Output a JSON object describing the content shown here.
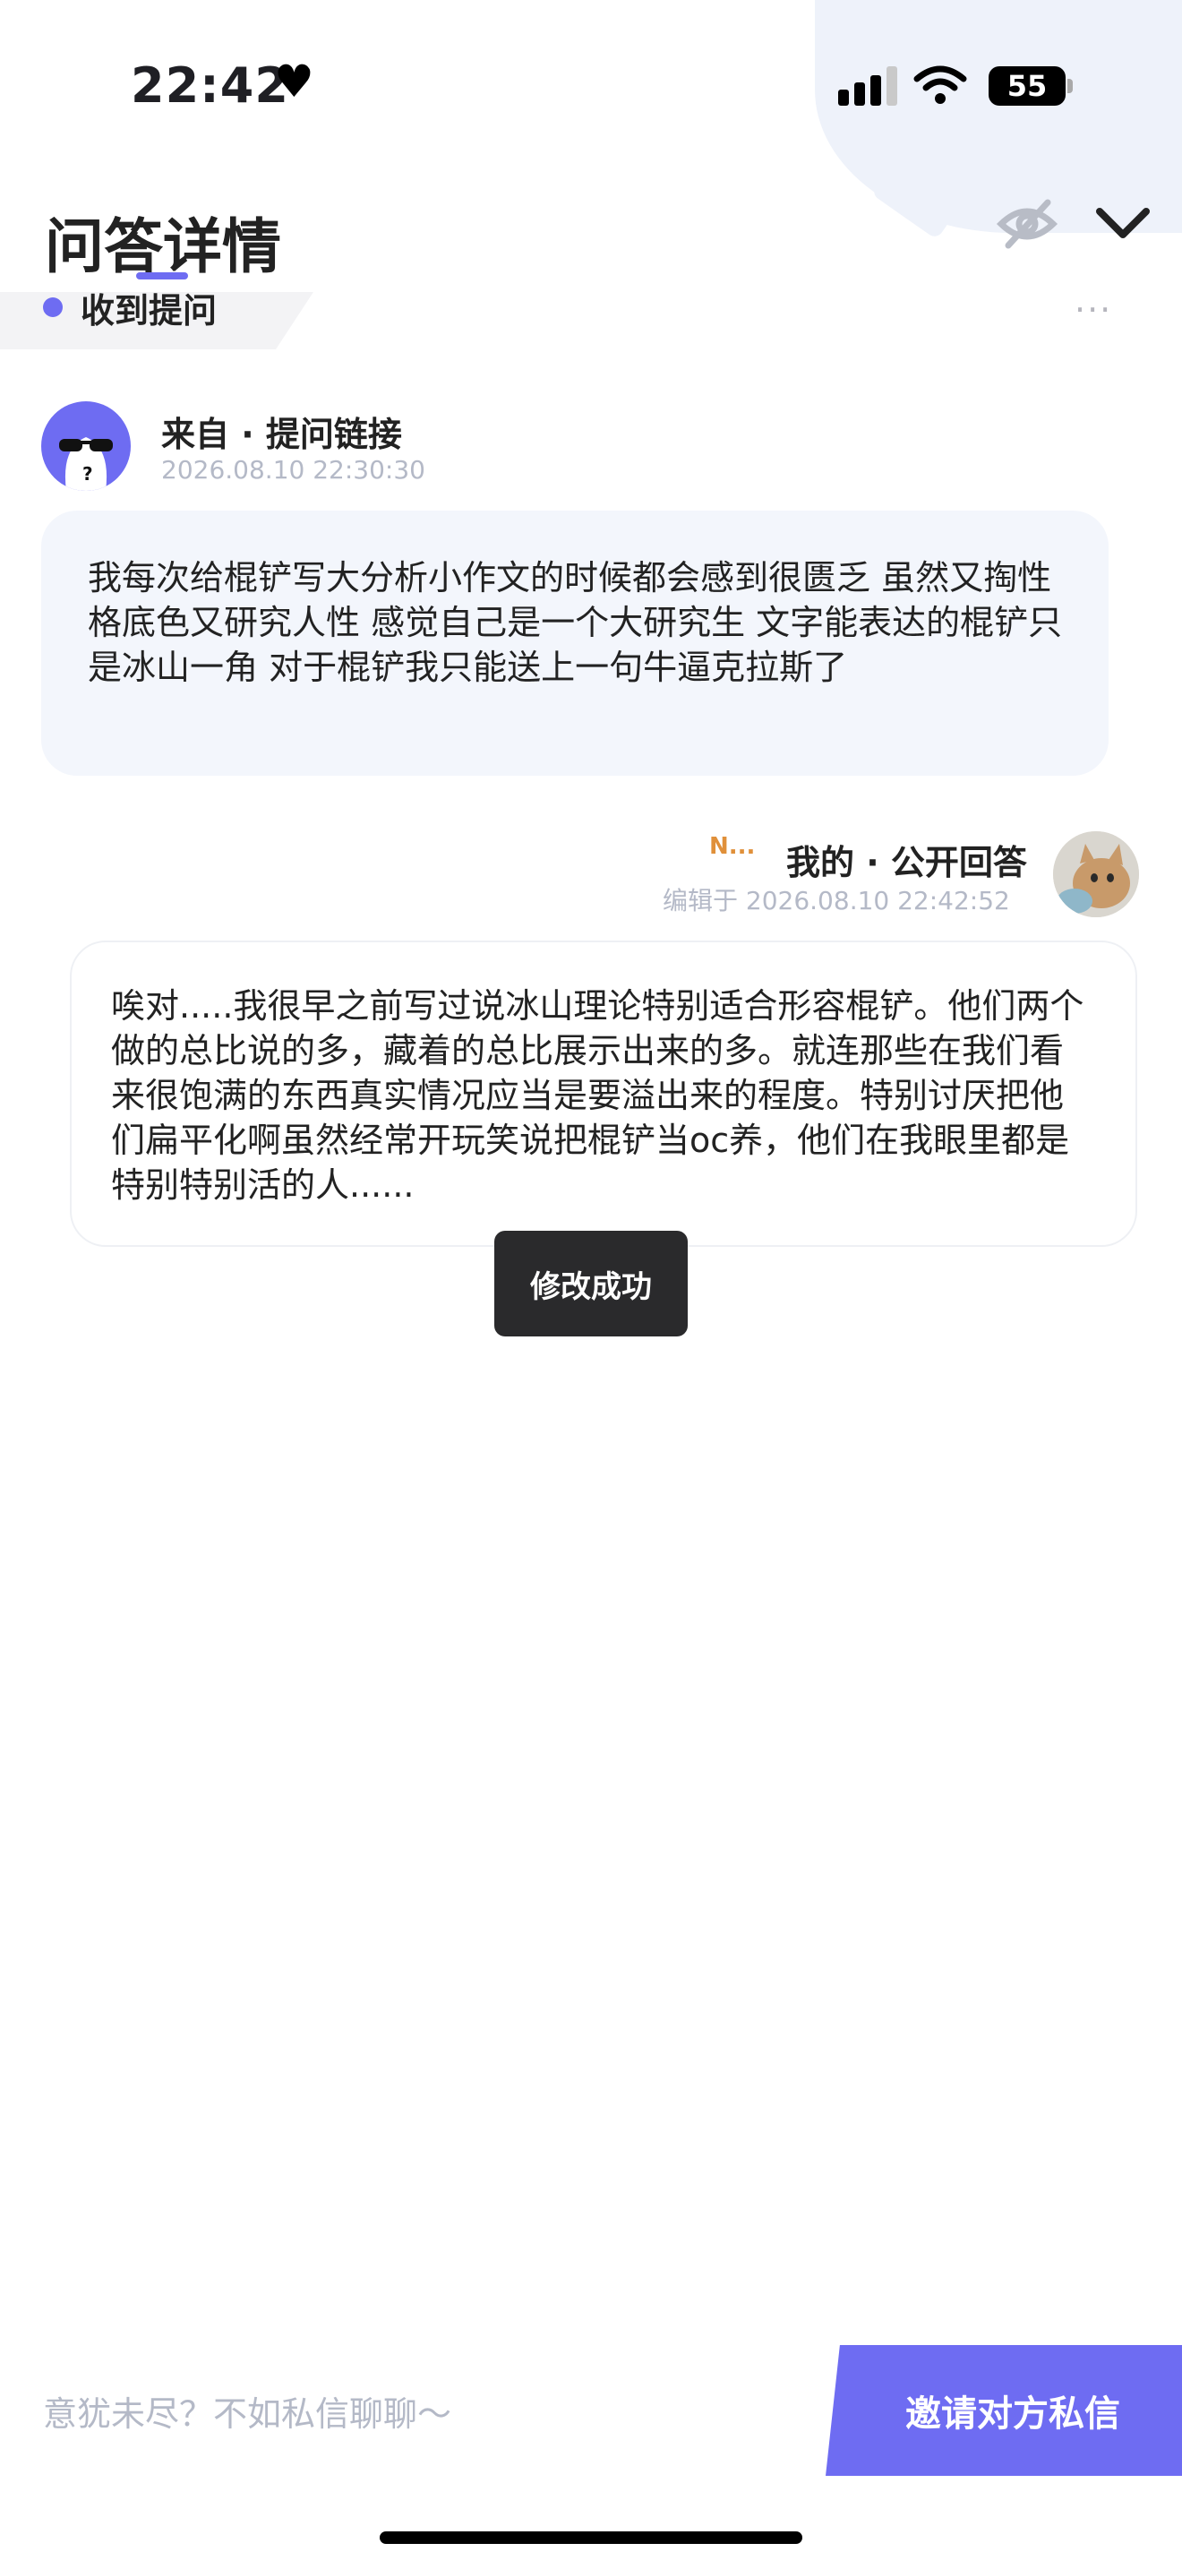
{
  "status_bar": {
    "time": "22:42",
    "battery": "55"
  },
  "header": {
    "title": "问答详情"
  },
  "tag": {
    "label": "收到提问",
    "more": "···"
  },
  "question": {
    "from": "来自 · 提问链接",
    "time": "2026.08.10 22:30:30",
    "text": "我每次给棍铲写大分析小作文的时候都会感到很匮乏 虽然又掏性格底色又研究人性 感觉自己是一个大研究生 文字能表达的棍铲只是冰山一角 对于棍铲我只能送上一句牛逼克拉斯了"
  },
  "answer": {
    "badge": "N...",
    "from": "我的 · 公开回答",
    "time": "编辑于 2026.08.10 22:42:52",
    "text": "唉对.....我很早之前写过说冰山理论特别适合形容棍铲。他们两个做的总比说的多，藏着的总比展示出来的多。就连那些在我们看来很饱满的东西真实情况应当是要溢出来的程度。特别讨厌把他们扁平化啊虽然经常开玩笑说把棍铲当oc养，他们在我眼里都是特别特别活的人......"
  },
  "toast": {
    "text": "修改成功"
  },
  "bottom": {
    "hint": "意犹未尽？不如私信聊聊～",
    "invite_label": "邀请对方私信"
  },
  "colors": {
    "accent": "#6e6cf2",
    "question_bubble": "#f3f6fc",
    "muted_text": "#b4b9c7",
    "toast_bg": "#2a2a2c"
  }
}
